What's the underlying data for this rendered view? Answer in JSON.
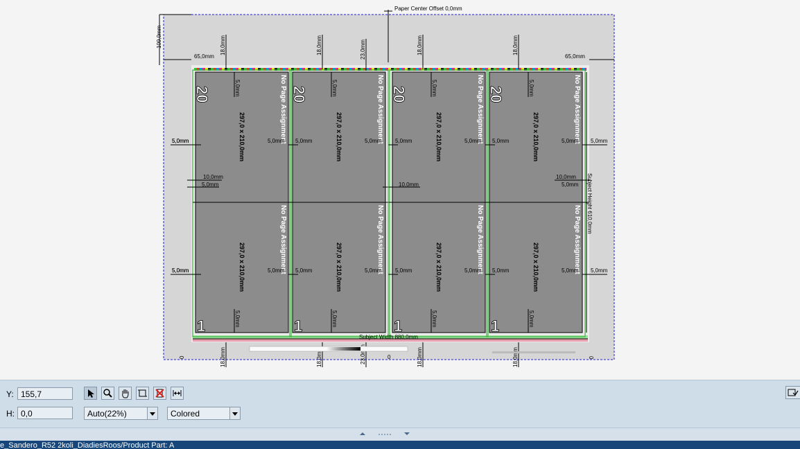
{
  "canvas": {
    "paper_center_offset": "Paper Center Offset 0,0mm",
    "subject_width": "Subject Width 880,0mm",
    "subject_height": "Subject Height 610,0mm",
    "paper_top": "109,0mm",
    "side_margin": "65,0mm",
    "gripper": "18,0mm",
    "center_gap": "23,0mm",
    "bleed": "5,0mm",
    "gutter_v": "10,0mm",
    "gutter_h": "10,0mm",
    "zero": "0",
    "page_label": "No Page Assignment",
    "page_size": "297,0 x 210,0mm",
    "top_page_number": "20",
    "bottom_page_number": "1"
  },
  "toolbar": {
    "y_label": "Y:",
    "y_value": "155,7",
    "h_label": "H:",
    "h_value": "0,0",
    "zoom_value": "Auto(22%)",
    "color_mode": "Colored"
  },
  "status": {
    "text": "e_Sandero_R52 2koli_DiadiesRoos/Product Part: A"
  },
  "colors": {
    "page_fill": "#8c8c8c",
    "sheet_fill": "#d6d6d6",
    "toolbar_bg": "#cfdde9",
    "statusbar_bg": "#16467a",
    "bleed_line": "#3cb43c"
  }
}
